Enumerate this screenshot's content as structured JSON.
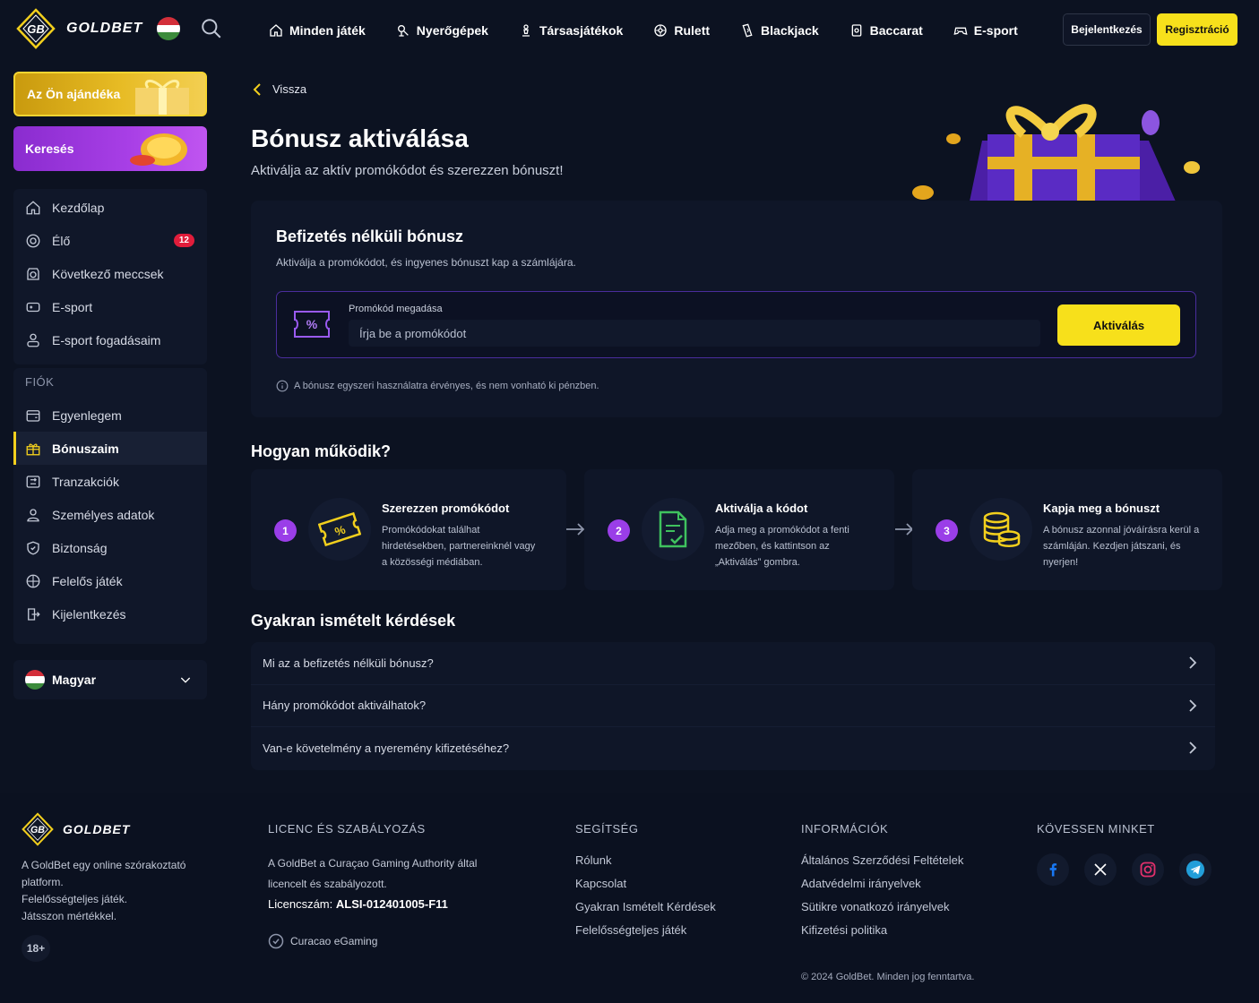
{
  "header": {
    "brand": "GOLDBET",
    "nav": [
      {
        "label": "Minden játék",
        "icon": "home-icon"
      },
      {
        "label": "Nyerőgépek",
        "icon": "slot-icon"
      },
      {
        "label": "Társasjátékok",
        "icon": "pawn-icon"
      },
      {
        "label": "Rulett",
        "icon": "roulette-icon"
      },
      {
        "label": "Blackjack",
        "icon": "cards-icon"
      },
      {
        "label": "Baccarat",
        "icon": "baccarat-icon"
      },
      {
        "label": "E-sport",
        "icon": "gamepad-icon"
      }
    ],
    "login": "Bejelentkezés",
    "register": "Regisztráció"
  },
  "sidebar": {
    "gift_card": "Az Ön ajándéka",
    "search_card": "Keresés",
    "main_items": [
      {
        "label": "Kezdőlap",
        "icon": "home-icon"
      },
      {
        "label": "Élő",
        "icon": "live-icon",
        "badge": "12"
      },
      {
        "label": "Következő meccsek",
        "icon": "calendar-icon"
      },
      {
        "label": "E-sport",
        "icon": "esport-icon"
      },
      {
        "label": "E-sport fogadásaim",
        "icon": "bets-icon"
      }
    ],
    "account_title": "FIÓK",
    "account_items": [
      {
        "label": "Egyenlegem",
        "icon": "wallet-icon"
      },
      {
        "label": "Bónuszaim",
        "icon": "gift-icon",
        "active": true
      },
      {
        "label": "Tranzakciók",
        "icon": "transactions-icon"
      },
      {
        "label": "Személyes adatok",
        "icon": "user-icon"
      },
      {
        "label": "Biztonság",
        "icon": "shield-icon"
      },
      {
        "label": "Felelős játék",
        "icon": "responsible-icon"
      },
      {
        "label": "Kijelentkezés",
        "icon": "logout-icon"
      }
    ],
    "language": "Magyar"
  },
  "main": {
    "back": "Vissza",
    "title": "Bónusz aktiválása",
    "subtitle": "Aktiválja az aktív promókódot és szerezzen bónuszt!",
    "bonus_card": {
      "title": "Befizetés nélküli bónusz",
      "description": "Aktiválja a promókódot, és ingyenes bónuszt kap a számlájára.",
      "input_label": "Promókód megadása",
      "input_placeholder": "Írja be a promókódot",
      "input_value": "",
      "button": "Aktiválás",
      "note": "A bónusz egyszeri használatra érvényes, és nem vonható ki pénzben."
    },
    "how_title": "Hogyan működik?",
    "steps": [
      {
        "num": "1",
        "title": "Szerezzen promókódot",
        "text": "Promókódokat találhat hirdetésekben, partnereinknél vagy a közösségi médiában.",
        "icon": "ticket-icon"
      },
      {
        "num": "2",
        "title": "Aktiválja a kódot",
        "text": "Adja meg a promókódot a fenti mezőben, és kattintson az „Aktiválás” gombra.",
        "icon": "document-check-icon"
      },
      {
        "num": "3",
        "title": "Kapja meg a bónuszt",
        "text": "A bónusz azonnal jóváírásra kerül a számláján. Kezdjen játszani, és nyerjen!",
        "icon": "coins-icon"
      }
    ],
    "faq_title": "Gyakran ismételt kérdések",
    "faq": [
      "Mi az a befizetés nélküli bónusz?",
      "Hány promókódot aktiválhatok?",
      "Van-e követelmény a nyeremény kifizetéséhez?"
    ]
  },
  "footer": {
    "brand": "GOLDBET",
    "about": "A GoldBet egy online szórakoztató platform.",
    "about_line2": "Felelősségteljes játék.",
    "about_line3": "Játsszon mértékkel.",
    "age": "18+",
    "license_title": "LICENC ÉS SZABÁLYOZÁS",
    "license_text": "A GoldBet a Curaçao Gaming Authority által licencelt és szabályozott.",
    "license_label": "Licencszám:",
    "license_number": "ALSI-012401005-F11",
    "curacao": "Curacao eGaming",
    "help_title": "SEGÍTSÉG",
    "help_links": [
      "Rólunk",
      "Kapcsolat",
      "Gyakran Ismételt Kérdések",
      "Felelősségteljes játék"
    ],
    "info_title": "INFORMÁCIÓK",
    "info_links": [
      "Általános Szerződési Feltételek",
      "Adatvédelmi irányelvek",
      "Sütikre vonatkozó irányelvek",
      "Kifizetési politika"
    ],
    "follow_title": "KÖVESSEN MINKET",
    "socials": [
      "facebook-icon",
      "x-icon",
      "instagram-icon",
      "telegram-icon"
    ],
    "copyright": "© 2024 GoldBet. Minden jog fenntartva."
  },
  "colors": {
    "background": "#0c1221",
    "accent_yellow": "#f7e01b",
    "accent_purple": "#9a3ee8",
    "badge_red": "#e11d3b"
  }
}
